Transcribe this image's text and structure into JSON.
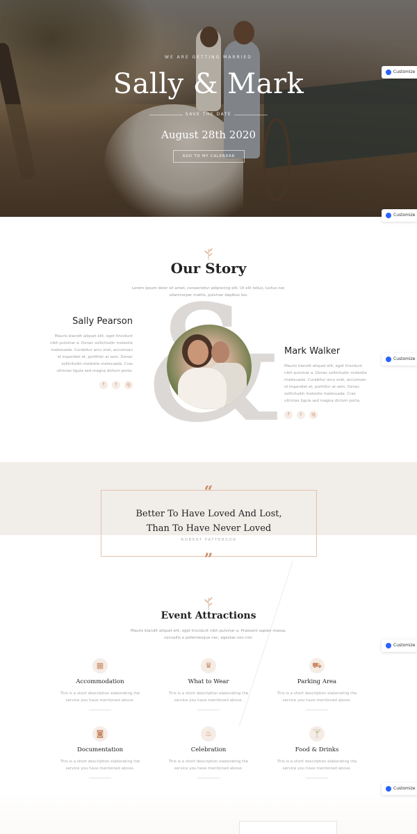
{
  "hero": {
    "eyebrow": "WE ARE GETTING MARRIED",
    "title": "Sally & Mark",
    "save_the_date": "SAVE THE DATE",
    "date": "August 28th 2020",
    "calendar_button": "ADD TO MY CALENDAR"
  },
  "customize_label": "Customize",
  "story": {
    "title": "Our Story",
    "description": "Lorem ipsum dolor sit amet, consectetur adipiscing elit. Ut elit tellus, luctus nec ullamcorper mattis, pulvinar dapibus leo.",
    "ampersand": "&",
    "left_person": {
      "name": "Sally Pearson",
      "bio": "Mauris blandit aliquet elit, eget tincidunt nibh pulvinar a. Donec sollicitudin molestie malesuada. Curabitur arcu erat, accumsan id imperdiet et, porttitor at sem. Donec sollicitudin molestie malesuada. Cras ultricies ligula sed magna dictum porta."
    },
    "right_person": {
      "name": "Mark Walker",
      "bio": "Mauris blandit aliquet elit, eget tincidunt nibh pulvinar a. Donec sollicitudin molestie malesuada. Curabitur arcu erat, accumsan id imperdiet et, porttitor at sem. Donec sollicitudin molestie malesuada. Cras ultricies ligula sed magna dictum porta."
    },
    "social_icons": [
      "f",
      "t",
      "ig"
    ]
  },
  "quote": {
    "open_mark": "“",
    "close_mark": "”",
    "line1": "Better To Have Loved And Lost,",
    "line2": "Than To Have Never Loved",
    "author": "ROBERT PATTERSON"
  },
  "events": {
    "title": "Event Attractions",
    "description": "Mauris blandit aliquet elit, eget tincidunt nibh pulvinar a. Praesent sapien massa, convallis a pellentesque nec, egestas non nisi.",
    "items": [
      {
        "icon": "▦",
        "icon_name": "hotel-icon",
        "title": "Accommodation",
        "desc": "This is a short description elaborating the service you have mentioned above."
      },
      {
        "icon": "♛",
        "icon_name": "crown-icon",
        "title": "What to Wear",
        "desc": "This is a short description elaborating the service you have mentioned above."
      },
      {
        "icon": "⛟",
        "icon_name": "car-icon",
        "title": "Parking Area",
        "desc": "This is a short description elaborating the service you have mentioned above."
      },
      {
        "icon": "◙",
        "icon_name": "camera-icon",
        "title": "Documentation",
        "desc": "This is a short description elaborating the service you have mentioned above."
      },
      {
        "icon": "♨",
        "icon_name": "cake-icon",
        "title": "Celebration",
        "desc": "This is a short description elaborating the service you have mentioned above."
      },
      {
        "icon": "🍸",
        "icon_name": "cocktail-icon",
        "title": "Food & Drinks",
        "desc": "This is a short description elaborating the service you have mentioned above."
      }
    ]
  },
  "colors": {
    "accent": "#c98a66",
    "quote_band": "#f1ede9",
    "customize_dot": "#2962ff"
  }
}
